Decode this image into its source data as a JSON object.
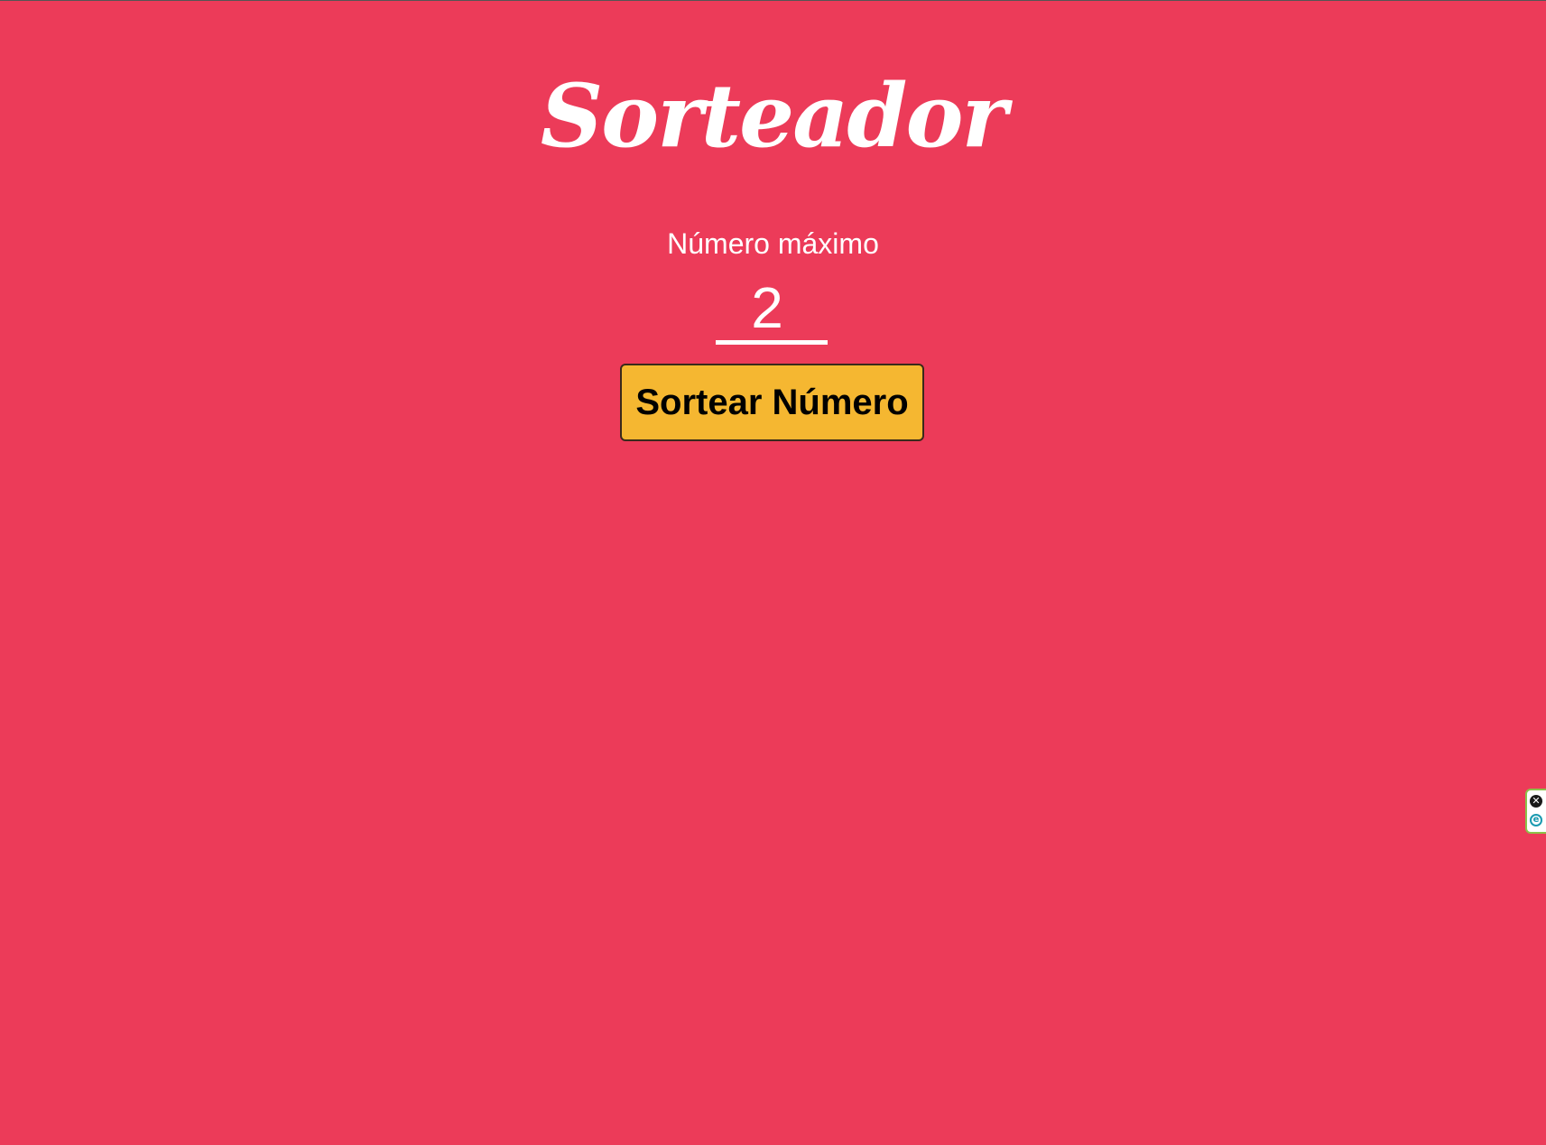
{
  "header": {
    "title": "Sorteador"
  },
  "form": {
    "label": "Número máximo",
    "max_value": "2",
    "button_label": "Sortear Número"
  },
  "widget": {
    "close_glyph": "✕",
    "logo_glyph": "e",
    "icons": [
      "close-icon",
      "edge-extension-icon"
    ]
  },
  "colors": {
    "background": "#ec3b59",
    "button": "#f5b731",
    "text": "#ffffff"
  }
}
